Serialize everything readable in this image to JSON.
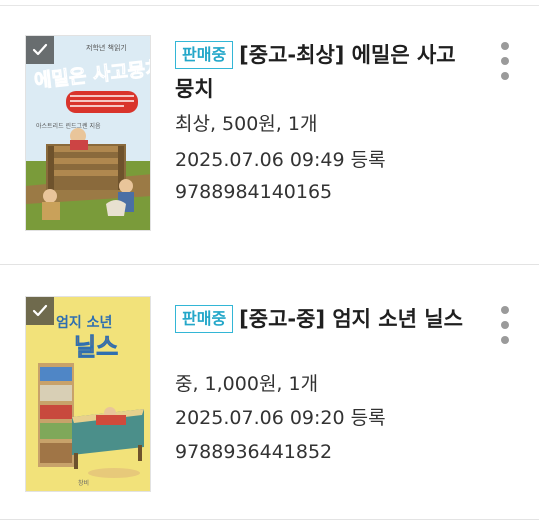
{
  "listings": [
    {
      "status_badge": "판매중",
      "title": "[중고-최상] 에밀은 사고뭉치",
      "condition_line": "최상, 500원, 1개",
      "date_line": "2025.07.06 09:49 등록",
      "isbn": "9788984140165",
      "cover": {
        "title_text": "에밀은 사고뭉치",
        "series_text": "저학년 책읽기",
        "subtitle_text": "아스트리드 린드그렌 지음",
        "colors": {
          "sky": "#dcebf4",
          "title": "#2d7fd0",
          "ground": "#7a9b3a"
        }
      }
    },
    {
      "status_badge": "판매중",
      "title": "[중고-중] 엄지 소년 닐스",
      "condition_line": "중, 1,000원, 1개",
      "date_line": "2025.07.06 09:20 등록",
      "isbn": "9788936441852",
      "cover": {
        "title_line1": "엄지 소년",
        "title_line2": "닐스",
        "publisher_text": "창비",
        "colors": {
          "background": "#f2e27a",
          "title": "#2f6fb0",
          "title2": "#f07f2a"
        }
      }
    }
  ],
  "colors": {
    "badge": "#24a7c9",
    "divider": "#e3e3e3",
    "more_icon": "#9a9a9a"
  }
}
